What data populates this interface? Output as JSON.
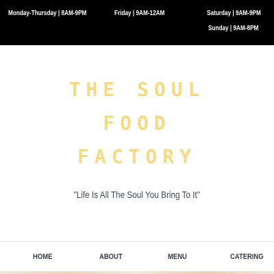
{
  "hours": {
    "weekdays": "Monday-Thursday | 8AM-9PM",
    "friday": "Friday | 9AM-12AM",
    "saturday": "Saturday | 9AM-9PM",
    "sunday": "Sunday | 9AM-8PM"
  },
  "hero": {
    "title_line1": "THE SOUL",
    "title_line2": "FOOD",
    "title_line3": "FACTORY",
    "tagline": "\"Life Is All The Soul You Bring To It\""
  },
  "nav": {
    "home": "HOME",
    "about": "ABOUT",
    "menu": "MENU",
    "catering": "CATERING"
  },
  "colors": {
    "title": "#f2cf6a",
    "hours_bar": "#000000",
    "nav_text": "#2f3a44"
  }
}
